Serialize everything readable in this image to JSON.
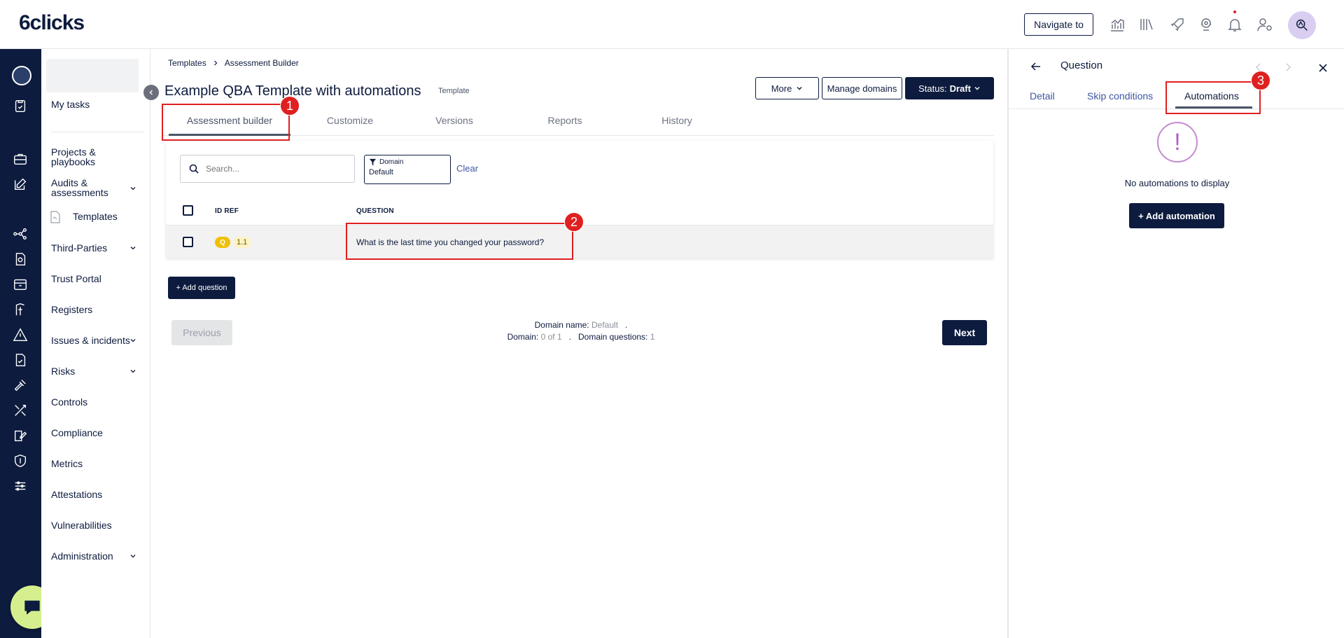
{
  "app": {
    "logo": "6clicks"
  },
  "header": {
    "navigate_label": "Navigate to"
  },
  "nav": {
    "items": [
      {
        "label": "My tasks"
      },
      {
        "label": "Projects & playbooks"
      },
      {
        "label": "Audits & assessments"
      },
      {
        "label": "Templates"
      },
      {
        "label": "Third-Parties"
      },
      {
        "label": "Trust Portal"
      },
      {
        "label": "Registers"
      },
      {
        "label": "Issues & incidents"
      },
      {
        "label": "Risks"
      },
      {
        "label": "Controls"
      },
      {
        "label": "Compliance"
      },
      {
        "label": "Metrics"
      },
      {
        "label": "Attestations"
      },
      {
        "label": "Vulnerabilities"
      },
      {
        "label": "Administration"
      }
    ]
  },
  "breadcrumb": {
    "root": "Templates",
    "current": "Assessment Builder"
  },
  "page": {
    "title": "Example QBA Template with automations",
    "tag": "Template",
    "more_label": "More",
    "manage_domains_label": "Manage domains",
    "status_prefix": "Status:",
    "status_value": "Draft"
  },
  "tabs": [
    {
      "label": "Assessment builder"
    },
    {
      "label": "Customize"
    },
    {
      "label": "Versions"
    },
    {
      "label": "Reports"
    },
    {
      "label": "History"
    }
  ],
  "table": {
    "search_placeholder": "Search...",
    "filter_label": "Domain",
    "filter_value": "Default",
    "clear_label": "Clear",
    "columns": [
      "ID REF",
      "QUESTION"
    ],
    "rows": [
      {
        "type_badge": "Q",
        "id_ref": "1.1",
        "question": "What is the last time you changed your password?"
      }
    ]
  },
  "actions": {
    "add_question": "+ Add question",
    "previous": "Previous",
    "next": "Next"
  },
  "pager": {
    "domain_name_label": "Domain name:",
    "domain_name_value": "Default",
    "domain_label": "Domain:",
    "domain_value": "0 of 1",
    "domain_questions_label": "Domain questions:",
    "domain_questions_value": "1",
    "separator": "."
  },
  "panel": {
    "title": "Question",
    "tabs": [
      {
        "label": "Detail"
      },
      {
        "label": "Skip conditions"
      },
      {
        "label": "Automations"
      }
    ],
    "empty_symbol": "!",
    "empty_text": "No automations to display",
    "add_automation": "+ Add automation"
  },
  "annotations": [
    "1",
    "2",
    "3"
  ],
  "colors": {
    "navy": "#0d1b3e",
    "link": "#3d56a6",
    "annotation": "#e02020",
    "chat": "#d6ef8e",
    "badge": "#f0c000"
  }
}
